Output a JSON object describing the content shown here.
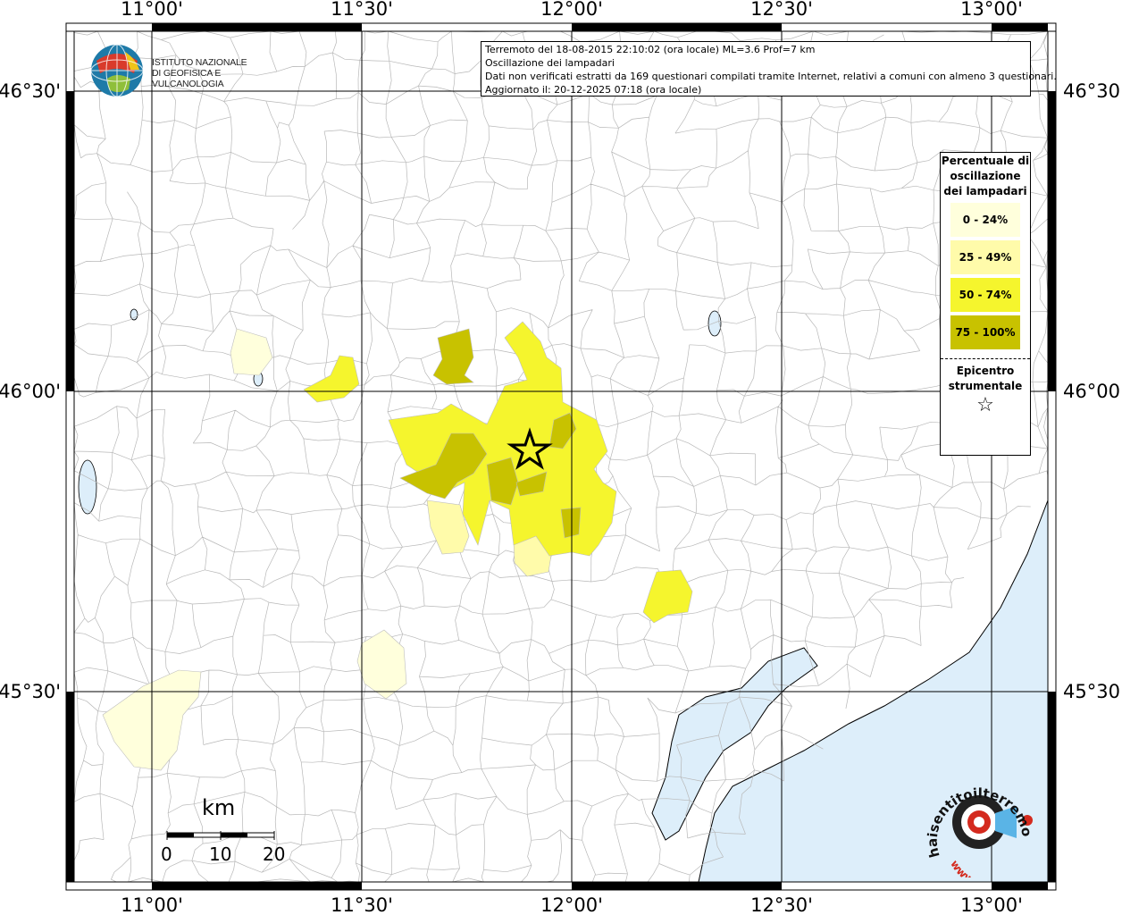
{
  "map": {
    "lon_ticks": [
      "11°00'",
      "11°30'",
      "12°00'",
      "12°30'",
      "13°00'"
    ],
    "lat_ticks": [
      "46°30'",
      "46°00'",
      "45°30'"
    ],
    "land_color": "#ffffff",
    "sea_color": "#ddeefa",
    "boundary_color": "#b8b8b8"
  },
  "logo": {
    "line1": "ISTITUTO NAZIONALE",
    "line2": "DI GEOFISICA E VULCANOLOGIA"
  },
  "info": {
    "line1": "Terremoto del 18-08-2015 22:10:02 (ora locale) ML=3.6 Prof=7 km",
    "line2": "Oscillazione dei lampadari",
    "line3": "Dati non verificati estratti da 169 questionari compilati tramite Internet, relativi a comuni con almeno 3 questionari.",
    "line4": "Aggiornato il: 20-12-2025 07:18 (ora locale)"
  },
  "legend": {
    "title": "Percentuale di oscillazione dei lampadari",
    "classes": [
      {
        "label": "0 - 24%",
        "color": "#ffffdc"
      },
      {
        "label": "25 - 49%",
        "color": "#fffbaa"
      },
      {
        "label": "50 - 74%",
        "color": "#f5f52d"
      },
      {
        "label": "75 - 100%",
        "color": "#c8c200"
      }
    ],
    "epicenter_title": "Epicentro strumentale",
    "epicenter_symbol": "☆"
  },
  "scalebar": {
    "unit": "km",
    "ticks": [
      "0",
      "10",
      "20"
    ]
  },
  "watermark": {
    "text": "haisentitoilterremoto.it",
    "url_text": "www."
  }
}
